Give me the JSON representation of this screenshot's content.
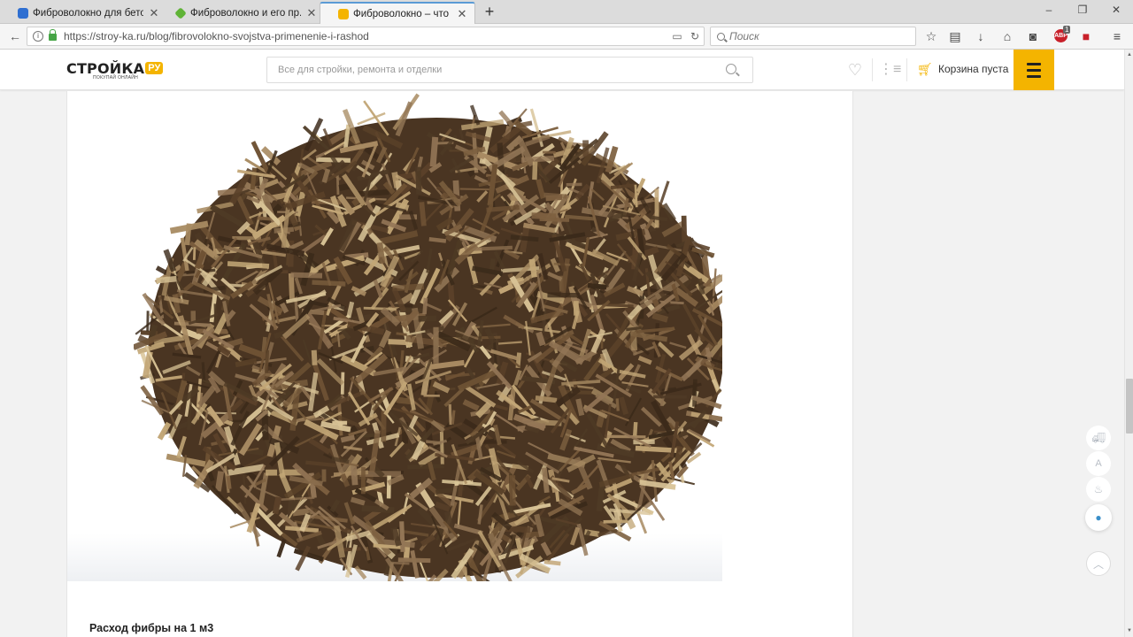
{
  "browser": {
    "tabs": [
      {
        "title": "Фиброволокно для бето...",
        "active": false,
        "icon": "globe-blue-icon"
      },
      {
        "title": "Фиброволокно и его пр...",
        "active": false,
        "icon": "leaf-green-icon"
      },
      {
        "title": "Фиброволокно – что это...",
        "active": true,
        "icon": "cart-yellow-icon"
      }
    ],
    "new_tab": "+",
    "url": "https://stroy-ka.ru/blog/fibrovolokno-svojstva-primenenie-i-rashod",
    "search_placeholder": "Поиск",
    "adblock_count": "1",
    "adblock_label": "ABP"
  },
  "site": {
    "logo_text": "СТРОЙКА",
    "logo_suffix": "РУ",
    "logo_tagline": "ПОКУПАЙ ОНЛАЙН",
    "search_placeholder": "Все для стройки, ремонта и отделки",
    "cart_label": "Корзина пуста",
    "accent_color": "#f4b400"
  },
  "article": {
    "image_subject": "fiber-heap-photo",
    "heading": "Расход фибры на 1 м3"
  },
  "rail": [
    "delivery-truck-icon",
    "font-size-icon",
    "fire-icon",
    "chat-icon",
    "scroll-up-icon"
  ]
}
